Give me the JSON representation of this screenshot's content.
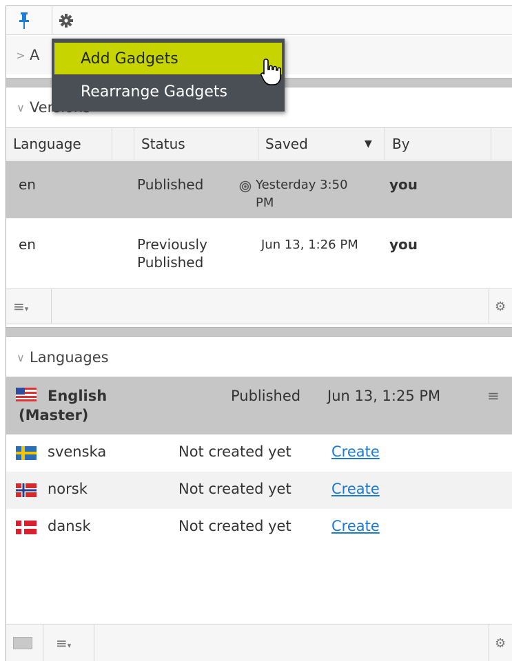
{
  "toolbar": {
    "pin_icon": "pin-icon",
    "settings_icon": "gear-icon"
  },
  "dropdown": {
    "items": [
      {
        "label": "Add Gadgets",
        "highlighted": true
      },
      {
        "label": "Rearrange Gadgets",
        "highlighted": false
      }
    ],
    "highlight_color": "#c8d400",
    "background_color": "#4a4f55"
  },
  "collapsed_gadget": {
    "title": "A"
  },
  "versions": {
    "title": "Versions",
    "columns": [
      "Language",
      "Status",
      "Saved",
      "By"
    ],
    "rows": [
      {
        "language": "en",
        "status": "Published",
        "saved_line1": "Yesterday 3:50",
        "saved_line2": "PM",
        "by": "you",
        "selected": true,
        "icon": "primary-version-icon"
      },
      {
        "language": "en",
        "status_line1": "Previously",
        "status_line2": "Published",
        "saved": "Jun 13, 1:26 PM",
        "by": "you",
        "selected": false
      }
    ]
  },
  "languages": {
    "title": "Languages",
    "master": {
      "name_line1": "English",
      "name_line2": "(Master)",
      "status": "Published",
      "date": "Jun 13, 1:25 PM"
    },
    "rows": [
      {
        "name": "svenska",
        "status": "Not created yet",
        "action": "Create",
        "flag": "se"
      },
      {
        "name": "norsk",
        "status": "Not created yet",
        "action": "Create",
        "flag": "no"
      },
      {
        "name": "dansk",
        "status": "Not created yet",
        "action": "Create",
        "flag": "dk"
      }
    ]
  },
  "colors": {
    "link": "#1c7ad1",
    "selected_row": "#c6c6c6"
  }
}
